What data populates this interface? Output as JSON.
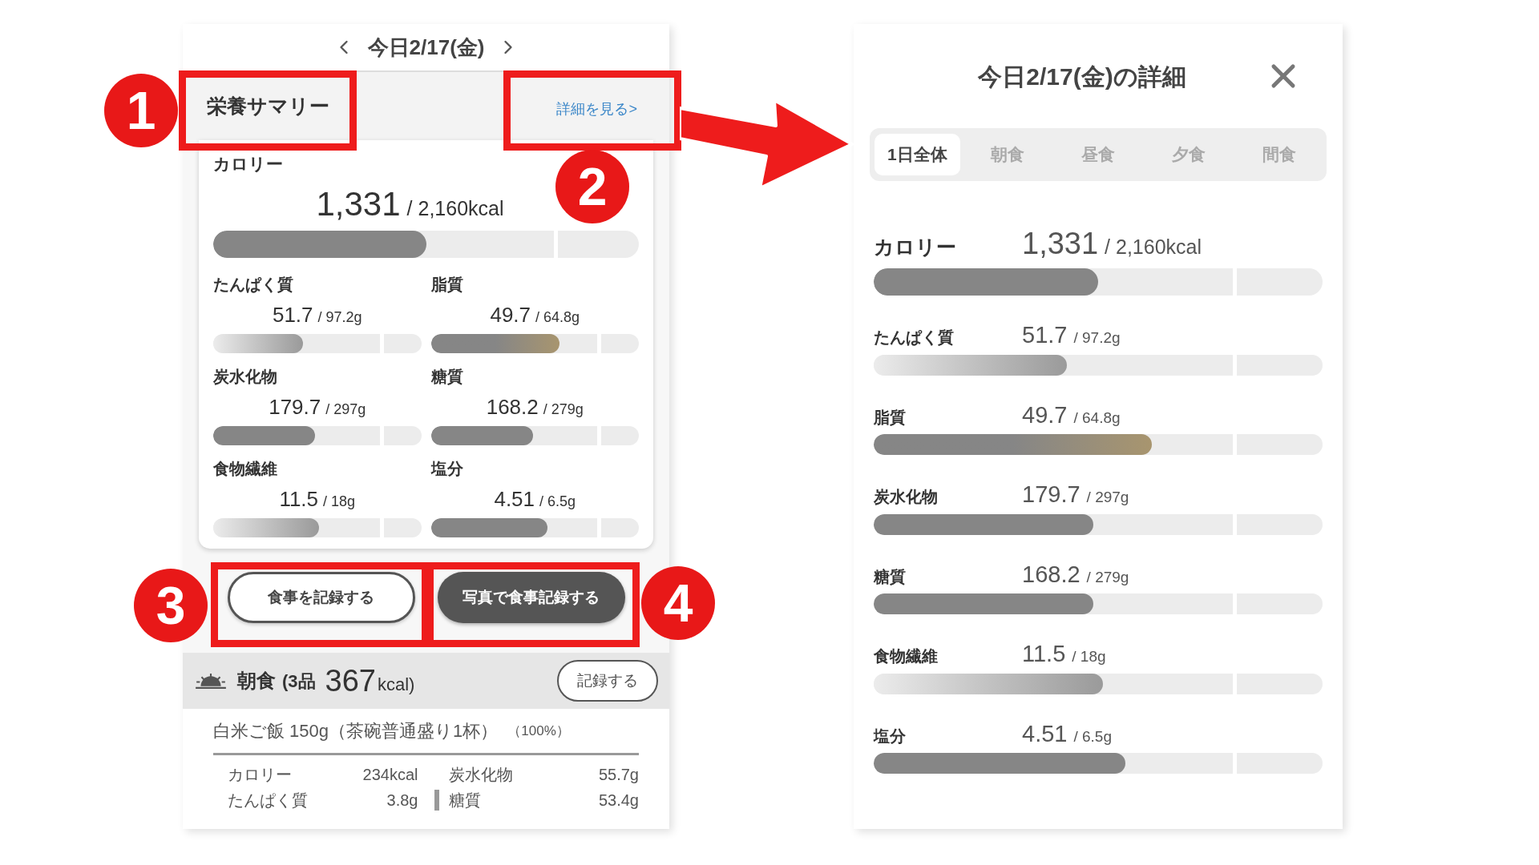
{
  "left": {
    "date_title": "今日2/17(金)",
    "summary": {
      "title": "栄養サマリー",
      "link": "詳細を見る>",
      "calorie": {
        "label": "カロリー",
        "value": "1,331",
        "target": "/ 2,160kcal",
        "level": 0.5,
        "kind": "solid"
      },
      "nutrients": [
        {
          "label": "たんぱく質",
          "value": "51.7",
          "target": "/ 97.2g",
          "level": 0.43,
          "kind": "fade"
        },
        {
          "label": "脂質",
          "value": "49.7",
          "target": "/ 64.8g",
          "level": 0.62,
          "kind": "warm"
        },
        {
          "label": "炭水化物",
          "value": "179.7",
          "target": "/ 297g",
          "level": 0.49,
          "kind": "solid"
        },
        {
          "label": "糖質",
          "value": "168.2",
          "target": "/ 279g",
          "level": 0.49,
          "kind": "solid"
        },
        {
          "label": "食物繊維",
          "value": "11.5",
          "target": "/ 18g",
          "level": 0.51,
          "kind": "fade"
        },
        {
          "label": "塩分",
          "value": "4.51",
          "target": "/ 6.5g",
          "level": 0.56,
          "kind": "solid"
        }
      ]
    },
    "buttons": [
      {
        "label": "食事を記録する",
        "kind": "outline"
      },
      {
        "label": "写真で食事記録する",
        "kind": "filled"
      }
    ],
    "meal": {
      "title": "朝食",
      "count": "(3品",
      "kcal": "367",
      "unit": "kcal)",
      "record_button": "記録する",
      "food": {
        "name": "白米ご飯 150g（茶碗普通盛り1杯）",
        "ratio": "（100%）"
      },
      "facts": [
        [
          {
            "label": "カロリー",
            "value": "234kcal",
            "sub": false
          },
          {
            "label": "炭水化物",
            "value": "55.7g",
            "sub": false
          }
        ],
        [
          {
            "label": "たんぱく質",
            "value": "3.8g",
            "sub": false
          },
          {
            "label": "糖質",
            "value": "53.4g",
            "sub": true
          }
        ]
      ]
    }
  },
  "right": {
    "title": "今日2/17(金)の詳細",
    "tabs": [
      {
        "label": "1日全体",
        "selected": true
      },
      {
        "label": "朝食",
        "selected": false
      },
      {
        "label": "昼食",
        "selected": false
      },
      {
        "label": "夕食",
        "selected": false
      },
      {
        "label": "間食",
        "selected": false
      }
    ],
    "rows": [
      {
        "label": "カロリー",
        "value": "1,331",
        "target": "/ 2,160kcal",
        "level": 0.5,
        "kind": "solid"
      },
      {
        "label": "たんぱく質",
        "value": "51.7",
        "target": "/ 97.2g",
        "level": 0.43,
        "kind": "fade"
      },
      {
        "label": "脂質",
        "value": "49.7",
        "target": "/ 64.8g",
        "level": 0.62,
        "kind": "warm"
      },
      {
        "label": "炭水化物",
        "value": "179.7",
        "target": "/ 297g",
        "level": 0.49,
        "kind": "solid"
      },
      {
        "label": "糖質",
        "value": "168.2",
        "target": "/ 279g",
        "level": 0.49,
        "kind": "solid"
      },
      {
        "label": "食物繊維",
        "value": "11.5",
        "target": "/ 18g",
        "level": 0.51,
        "kind": "fade"
      },
      {
        "label": "塩分",
        "value": "4.51",
        "target": "/ 6.5g",
        "level": 0.56,
        "kind": "solid"
      }
    ]
  },
  "annotations": [
    {
      "number": "1"
    },
    {
      "number": "2"
    },
    {
      "number": "3"
    },
    {
      "number": "4"
    }
  ]
}
